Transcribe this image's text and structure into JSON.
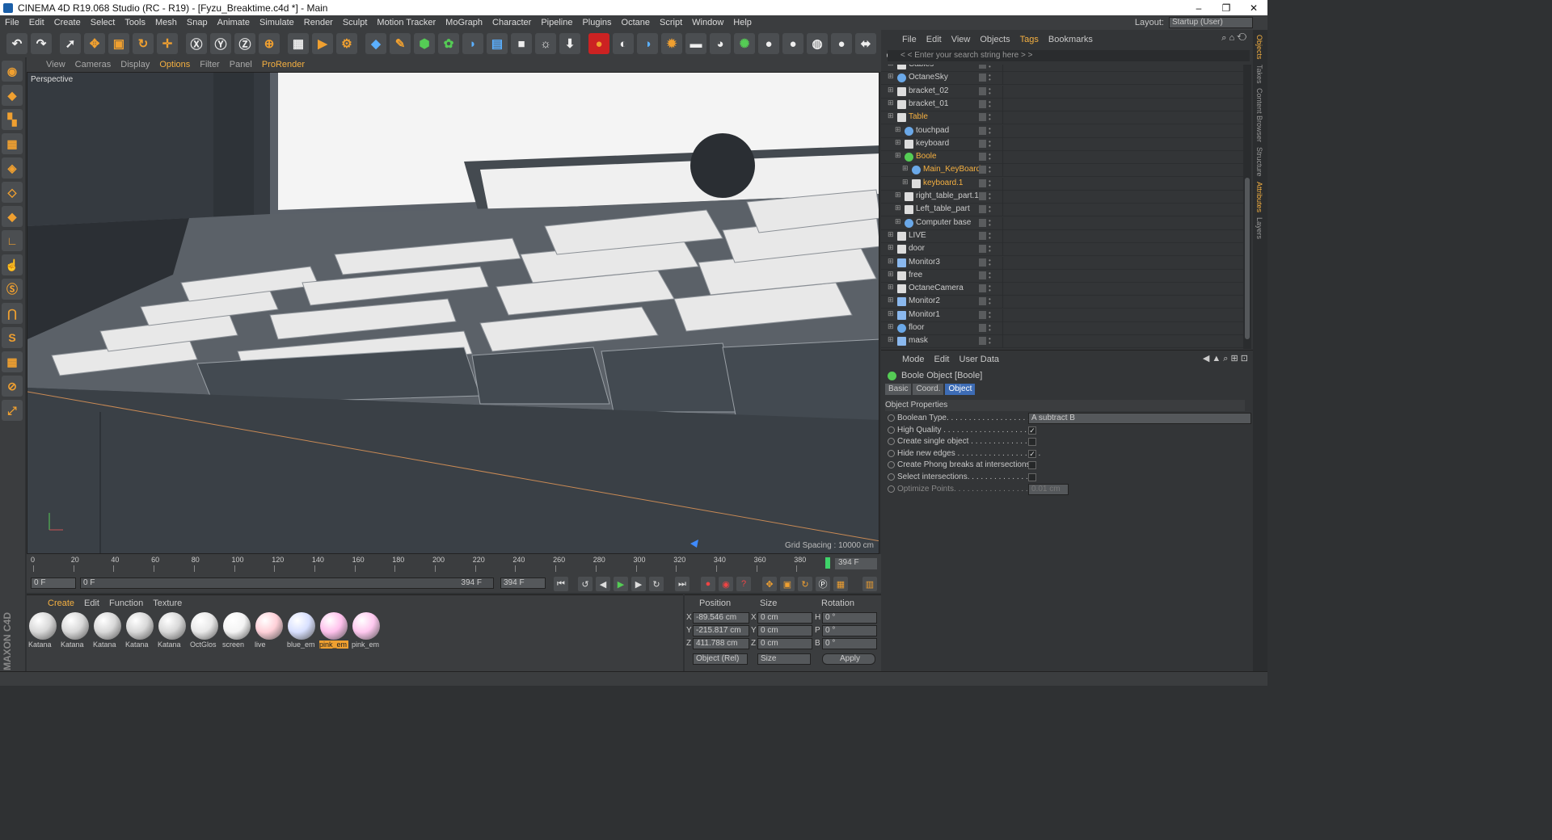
{
  "window": {
    "title": "CINEMA 4D R19.068 Studio (RC - R19) - [Fyzu_Breaktime.c4d *] - Main",
    "buttons": [
      "–",
      "❐",
      "✕"
    ]
  },
  "menubar": [
    "File",
    "Edit",
    "Create",
    "Select",
    "Tools",
    "Mesh",
    "Snap",
    "Animate",
    "Simulate",
    "Render",
    "Sculpt",
    "Motion Tracker",
    "MoGraph",
    "Character",
    "Pipeline",
    "Plugins",
    "Octane",
    "Script",
    "Window",
    "Help"
  ],
  "layout": {
    "label": "Layout:",
    "value": "Startup (User)"
  },
  "viewport": {
    "menu": [
      "View",
      "Cameras",
      "Display",
      "Options",
      "Filter",
      "Panel",
      "ProRender"
    ],
    "label": "Perspective",
    "grid_spacing": "Grid Spacing : 10000 cm"
  },
  "timeline": {
    "ticks": [
      "0",
      "20",
      "40",
      "60",
      "80",
      "100",
      "120",
      "140",
      "160",
      "180",
      "200",
      "220",
      "240",
      "260",
      "280",
      "300",
      "320",
      "340",
      "360",
      "380"
    ],
    "end_frame": "394 F",
    "start_field": "0 F",
    "range_start": "0 F",
    "range_end": "394 F",
    "end_field": "394 F"
  },
  "materials": {
    "menu": [
      "Create",
      "Edit",
      "Function",
      "Texture"
    ],
    "items": [
      {
        "name": "Katana",
        "color": "#d8d8d8"
      },
      {
        "name": "Katana",
        "color": "#d8d8d8"
      },
      {
        "name": "Katana",
        "color": "#d8d8d8"
      },
      {
        "name": "Katana",
        "color": "#d8d8d8"
      },
      {
        "name": "Katana",
        "color": "#d8d8d8"
      },
      {
        "name": "OctGlos",
        "color": "#e8e8e8"
      },
      {
        "name": "screen",
        "color": "#f4f4f4"
      },
      {
        "name": "live",
        "color": "#ffd0d8"
      },
      {
        "name": "blue_em",
        "color": "#d8e0ff"
      },
      {
        "name": "pink_em",
        "color": "#ffc0ec"
      },
      {
        "name": "pink_em",
        "color": "#ffc8ef"
      }
    ]
  },
  "coords": {
    "headers": [
      "Position",
      "Size",
      "Rotation"
    ],
    "rows": [
      {
        "axis": "X",
        "pos": "-89.546 cm",
        "size_axis": "X",
        "size": "0 cm",
        "rot_axis": "H",
        "rot": "0 °"
      },
      {
        "axis": "Y",
        "pos": "-215.817 cm",
        "size_axis": "Y",
        "size": "0 cm",
        "rot_axis": "P",
        "rot": "0 °"
      },
      {
        "axis": "Z",
        "pos": "411.788 cm",
        "size_axis": "Z",
        "size": "0 cm",
        "rot_axis": "B",
        "rot": "0 °"
      }
    ],
    "mode": "Object (Rel)",
    "size_mode": "Size",
    "apply": "Apply"
  },
  "objects": {
    "menu": [
      "File",
      "Edit",
      "View",
      "Objects",
      "Tags",
      "Bookmarks"
    ],
    "search_placeholder": "< < Enter your search string here > >",
    "rows": [
      {
        "name": "Cables",
        "indent": 0,
        "icon": "null-icon"
      },
      {
        "name": "OctaneSky",
        "indent": 0,
        "icon": "sky-icon"
      },
      {
        "name": "bracket_02",
        "indent": 0,
        "icon": "null-icon"
      },
      {
        "name": "bracket_01",
        "indent": 0,
        "icon": "null-icon"
      },
      {
        "name": "Table",
        "indent": 0,
        "icon": "null-icon",
        "orange": true
      },
      {
        "name": "touchpad",
        "indent": 1,
        "icon": "poly-icon"
      },
      {
        "name": "keyboard",
        "indent": 1,
        "icon": "null-icon"
      },
      {
        "name": "Boole",
        "indent": 1,
        "icon": "boole-icon",
        "orange": true
      },
      {
        "name": "Main_KeyBoard",
        "indent": 2,
        "icon": "poly-icon",
        "orange": true
      },
      {
        "name": "keyboard.1",
        "indent": 2,
        "icon": "null-icon",
        "orange": true
      },
      {
        "name": "right_table_part.1",
        "indent": 1,
        "icon": "null-icon"
      },
      {
        "name": "Left_table_part",
        "indent": 1,
        "icon": "null-icon"
      },
      {
        "name": "Computer base",
        "indent": 1,
        "icon": "poly-icon"
      },
      {
        "name": "LIVE",
        "indent": 0,
        "icon": "null-icon"
      },
      {
        "name": "door",
        "indent": 0,
        "icon": "null-icon"
      },
      {
        "name": "Monitor3",
        "indent": 0,
        "icon": "light-icon"
      },
      {
        "name": "free",
        "indent": 0,
        "icon": "camera-icon"
      },
      {
        "name": "OctaneCamera",
        "indent": 0,
        "icon": "camera-icon"
      },
      {
        "name": "Monitor2",
        "indent": 0,
        "icon": "light-icon"
      },
      {
        "name": "Monitor1",
        "indent": 0,
        "icon": "light-icon"
      },
      {
        "name": "floor",
        "indent": 0,
        "icon": "poly-icon"
      },
      {
        "name": "mask",
        "indent": 0,
        "icon": "light-icon"
      }
    ]
  },
  "attributes": {
    "menu": [
      "Mode",
      "Edit",
      "User Data"
    ],
    "title": "Boole Object [Boole]",
    "tabs": [
      "Basic",
      "Coord.",
      "Object"
    ],
    "section": "Object Properties",
    "props": [
      {
        "label": "Boolean Type. . . . . . . . . . . . . . . . . . . . .",
        "value": "A subtract B",
        "type": "select"
      },
      {
        "label": "High Quality . . . . . . . . . . . . . . . . . . . .",
        "value": "✓",
        "type": "check"
      },
      {
        "label": "Create single object . . . . . . . . . . . . . . .",
        "value": "",
        "type": "check"
      },
      {
        "label": "Hide new edges . . . . . . . . . . . . . . . . . . .",
        "value": "✓",
        "type": "check"
      },
      {
        "label": "Create Phong breaks at intersections",
        "value": "",
        "type": "check"
      },
      {
        "label": "Select intersections. . . . . . . . . . . . . . . .",
        "value": "",
        "type": "check"
      },
      {
        "label": "Optimize Points. . . . . . . . . . . . . . . . . . .",
        "value": "0.01 cm",
        "type": "field"
      }
    ]
  },
  "right_tabs": [
    "Objects",
    "Takes",
    "Content Browser",
    "Structure",
    "Attributes",
    "Layers"
  ]
}
